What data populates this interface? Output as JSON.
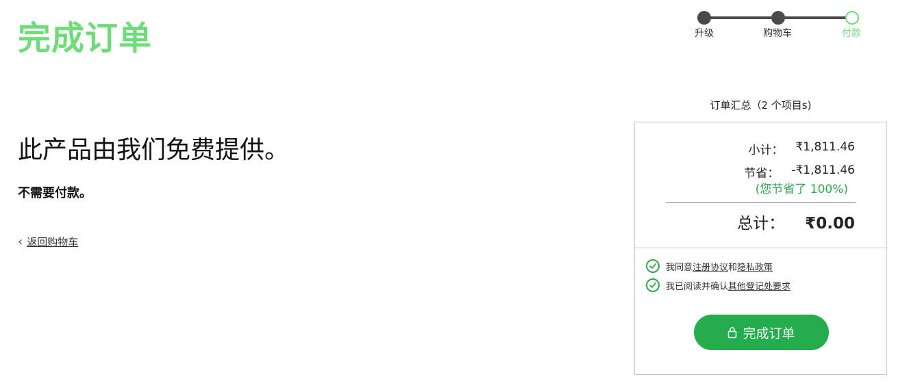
{
  "header": {
    "title": "完成订单"
  },
  "stepper": {
    "steps": [
      {
        "label": "升级"
      },
      {
        "label": "购物车"
      },
      {
        "label": "付款"
      }
    ]
  },
  "main": {
    "heading": "此产品由我们免费提供。",
    "subheading": "不需要付款。",
    "back_link": "返回购物车"
  },
  "summary": {
    "title": "订单汇总（2 个项目s)",
    "subtotal_label": "小计：",
    "subtotal_value": "₹1,811.46",
    "savings_label": "节省：",
    "savings_value": "-₹1,811.46",
    "savings_percent": "(您节省了 100%)",
    "total_label": "总计：",
    "total_value": "₹0.00",
    "agree1": {
      "prefix": "我同意",
      "link1": "注册协议",
      "middle": "和",
      "link2": "隐私政策"
    },
    "agree2": {
      "prefix": "我已阅读并确认",
      "link": "其他登记处要求"
    },
    "button_label": "完成订单"
  },
  "colors": {
    "accent_green": "#6fdc7a",
    "button_green": "#23ad4c",
    "check_green": "#2aa84a"
  }
}
